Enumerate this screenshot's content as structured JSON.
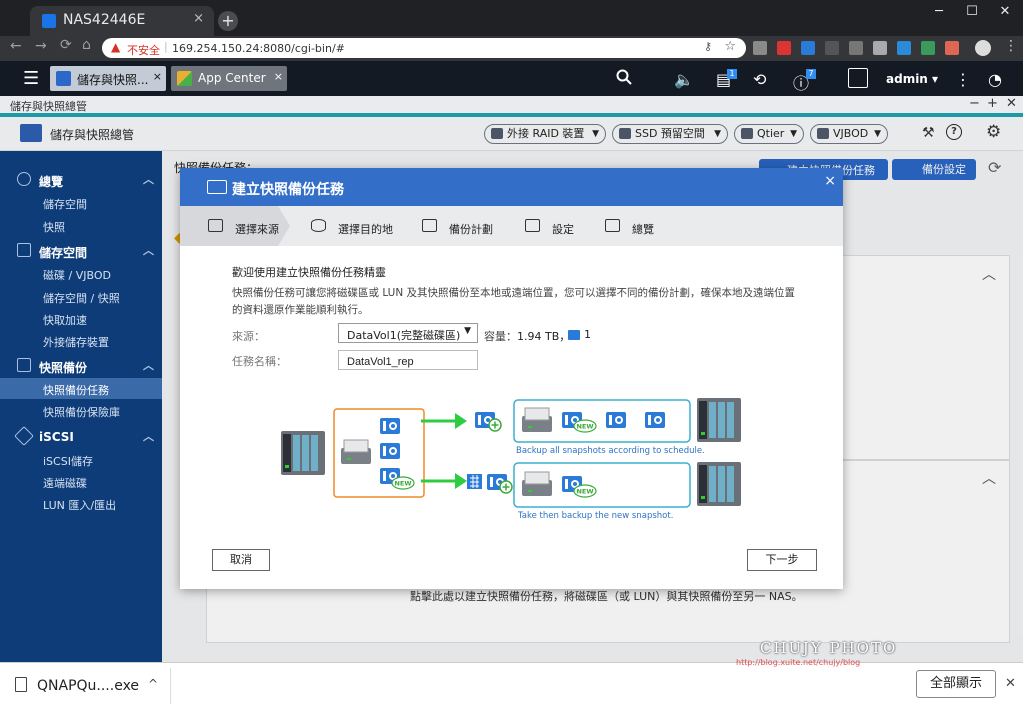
{
  "browser": {
    "tab_title": "NAS42446E",
    "tab_close": "×",
    "new_tab": "+",
    "window_controls": [
      "─",
      "☐",
      "✕"
    ],
    "nav_buttons": [
      "←",
      "→",
      "⟳"
    ],
    "security_label": "不安全",
    "url": "169.254.150.24:8080/cgi-bin/#",
    "extension_colors": [
      "#8a8a8a",
      "#d33",
      "#2a7ad8",
      "#555",
      "#777",
      "#aaa",
      "#2a8ad8",
      "#3a9a5a",
      "#d65"
    ]
  },
  "qts": {
    "app_tabs": [
      {
        "label": "儲存與快照...",
        "close": "×",
        "color": "#2b68c8"
      },
      {
        "label": "App Center",
        "close": "×",
        "color": "#e8b030"
      }
    ],
    "user": "admin",
    "badges": {
      "tasks": "1",
      "notifications": "7"
    },
    "icons": [
      "search-icon",
      "volume-icon",
      "tasks-icon",
      "sync-icon",
      "notification-icon",
      "user-icon",
      "more-icon",
      "dashboard-icon"
    ]
  },
  "app": {
    "window_title": "儲存與快照總管",
    "window_controls": [
      "−",
      "+",
      "✕"
    ],
    "title": "儲存與快照總管",
    "header_buttons": [
      "外接 RAID 裝置",
      "SSD 預留空間",
      "Qtier",
      "VJBOD"
    ],
    "accent": "#336fc8",
    "sidebar": {
      "groups": [
        {
          "label": "總覽",
          "items": [
            "儲存空間",
            "快照"
          ]
        },
        {
          "label": "儲存空間",
          "items": [
            "磁碟 / VJBOD",
            "儲存空間 / 快照",
            "快取加速",
            "外接儲存裝置"
          ]
        },
        {
          "label": "快照備份",
          "items": [
            "快照備份任務",
            "快照備份保險庫"
          ]
        },
        {
          "label": "iSCSI",
          "items": [
            "iSCSI儲存",
            "遠端磁碟",
            "LUN 匯入/匯出"
          ]
        }
      ],
      "active_item": "快照備份任務"
    },
    "main_title": "快照備份任務：",
    "main_buttons": [
      "建立快照備份任務",
      "備份設定"
    ],
    "bottom_note": "點擊此處以建立快照備份任務，將磁碟區（或 LUN）與其快照備份至另一 NAS。"
  },
  "modal": {
    "title": "建立快照備份任務",
    "close": "×",
    "steps": [
      "選擇來源",
      "選擇目的地",
      "備份計劃",
      "設定",
      "總覽"
    ],
    "active_step": 0,
    "intro_title": "歡迎使用建立快照備份任務精靈",
    "intro_text": "快照備份任務可讓您將磁碟區或 LUN 及其快照備份至本地或遠端位置，您可以選擇不同的備份計劃，確保本地及遠端位置的資料還原作業能順利執行。",
    "source_label": "來源：",
    "source_value": "DataVol1(完整磁碟區)",
    "capacity_label": "容量：",
    "capacity_value": "1.94 TB，",
    "snapshot_count": "1",
    "task_name_label": "任務名稱：",
    "task_name_value": "DataVol1_rep",
    "diagram": {
      "new_badge": "NEW",
      "caption1": "Backup all snapshots according to schedule.",
      "caption2": "Take then backup the new snapshot."
    },
    "cancel": "取消",
    "next": "下一步"
  },
  "footer": {
    "download_name": "QNAPQu....exe",
    "download_chevron": "^",
    "show_all": "全部顯示",
    "close": "✕"
  },
  "watermark": {
    "title": "CHUJY PHOTO",
    "url": "http://blog.xuite.net/chujy/blog"
  }
}
